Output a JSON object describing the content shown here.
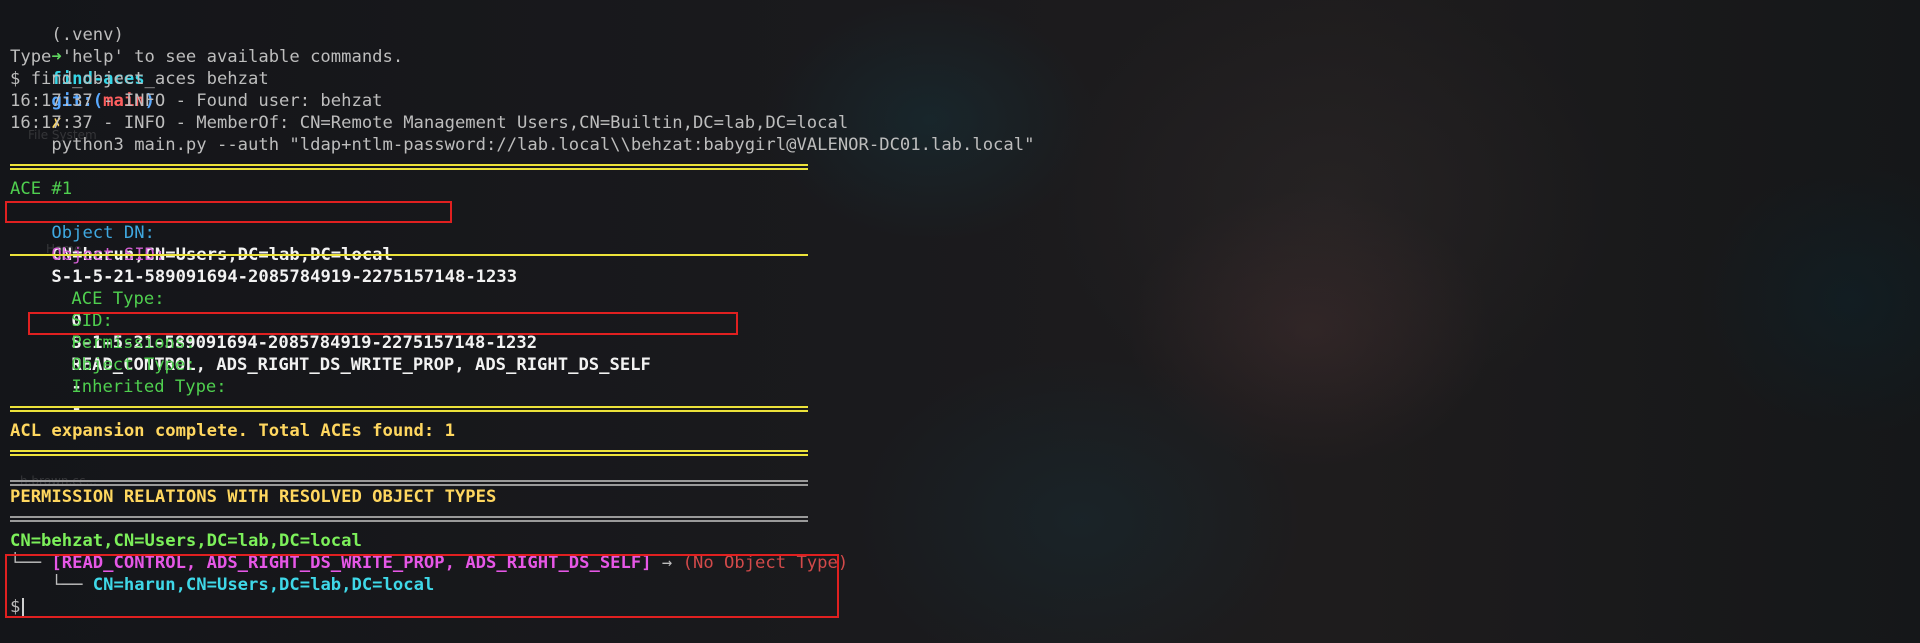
{
  "prompt": {
    "venv": "(.venv)",
    "arrow": "➜",
    "dir": "find-aces",
    "git_prefix": "git:(",
    "branch": "main",
    "git_suffix": ")",
    "dirty": "✗",
    "command": "python3 main.py --auth \"ldap+ntlm-password://lab.local\\\\behzat:babygirl@VALENOR-DC01.lab.local\""
  },
  "output": {
    "help_line": "Type 'help' to see available commands.",
    "cmd_line": "$ find_object_aces behzat",
    "log1": "16:17:37 - INFO - Found user: behzat",
    "log2": "16:17:37 - INFO - MemberOf: CN=Remote Management Users,CN=Builtin,DC=lab,DC=local"
  },
  "ace": {
    "header": "ACE #1",
    "object_dn_label": "Object DN:",
    "object_dn_value": "CN=harun,CN=Users,DC=lab,DC=local",
    "object_sid_label": "Object SID:",
    "object_sid_value": "S-1-5-21-589091694-2085784919-2275157148-1233",
    "ace_type_label": "ACE Type:",
    "ace_type_value": "0",
    "sid_label": "SID:",
    "sid_value": "S-1-5-21-589091694-2085784919-2275157148-1232",
    "permissions_label": "Permissions:",
    "permissions_value": "READ_CONTROL, ADS_RIGHT_DS_WRITE_PROP, ADS_RIGHT_DS_SELF",
    "object_type_label": "Object Type:",
    "object_type_value": "-",
    "inherited_type_label": "Inherited Type:",
    "inherited_type_value": "-"
  },
  "summary": {
    "complete": "ACL expansion complete. Total ACEs found: 1",
    "relations_title": "PERMISSION RELATIONS WITH RESOLVED OBJECT TYPES"
  },
  "relations": {
    "source": "CN=behzat,CN=Users,DC=lab,DC=local",
    "branch1": "└── ",
    "perms": "[READ_CONTROL, ADS_RIGHT_DS_WRITE_PROP, ADS_RIGHT_DS_SELF]",
    "arrow": " → ",
    "no_obj": "(No Object Type)",
    "branch2": "    └── ",
    "target": "CN=harun,CN=Users,DC=lab,DC=local"
  },
  "final_prompt": "$",
  "background_ghosts": {
    "file_system": "File System",
    "home": "Home",
    "file": "h.brown.cc..."
  }
}
